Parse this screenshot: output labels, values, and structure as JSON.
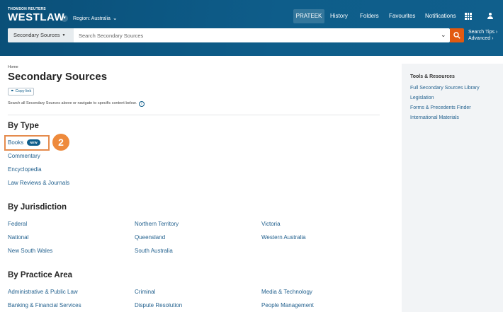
{
  "header": {
    "brand_top": "THOMSON REUTERS",
    "brand_main": "WESTLAW",
    "region": "Region: Australia",
    "nav": {
      "user": "PRATEEK",
      "history": "History",
      "folders": "Folders",
      "favourites": "Favourites",
      "notifications": "Notifications"
    },
    "search": {
      "scope": "Secondary Sources",
      "placeholder": "Search Secondary Sources",
      "tips": "Search Tips",
      "advanced": "Advanced"
    },
    "colors": {
      "header_bg": "#0e5d8a",
      "search_button": "#e25a10"
    }
  },
  "main": {
    "breadcrumb": "Home",
    "title": "Secondary Sources",
    "copy_link": "Copy link",
    "helper": "Search all Secondary Sources above or navigate to specific content below.",
    "by_type": {
      "heading": "By Type",
      "items": [
        "Books",
        "Commentary",
        "Encyclopedia",
        "Law Reviews & Journals"
      ],
      "new_badge": "NEW"
    },
    "step_marker": "2",
    "by_jurisdiction": {
      "heading": "By Jurisdiction",
      "col1": [
        "Federal",
        "National",
        "New South Wales"
      ],
      "col2": [
        "Northern Territory",
        "Queensland",
        "South Australia"
      ],
      "col3": [
        "Victoria",
        "Western Australia"
      ]
    },
    "by_practice_area": {
      "heading": "By Practice Area",
      "col1": [
        "Administrative & Public Law",
        "Banking & Financial Services"
      ],
      "col2": [
        "Criminal",
        "Dispute Resolution"
      ],
      "col3": [
        "Media & Technology",
        "People Management"
      ]
    }
  },
  "sidebar": {
    "title": "Tools & Resources",
    "links": [
      "Full Secondary Sources Library",
      "Legislation",
      "Forms & Precedents Finder",
      "International Materials"
    ]
  }
}
